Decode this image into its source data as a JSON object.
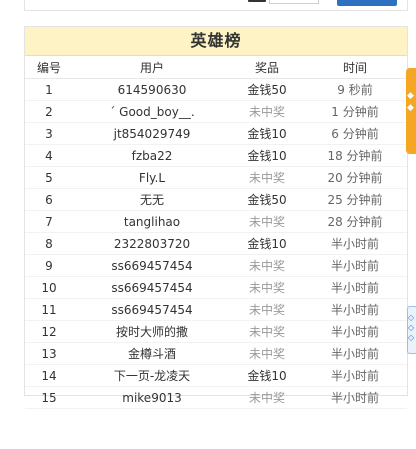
{
  "panel": {
    "title": "英雄榜",
    "columns": [
      "编号",
      "用户",
      "奖品",
      "时间"
    ]
  },
  "rows": [
    {
      "idx": "1",
      "user": "614590630",
      "prize": "金钱50",
      "won": true,
      "time": "9 秒前"
    },
    {
      "idx": "2",
      "user": "ˊ Good_boy__.",
      "prize": "未中奖",
      "won": false,
      "time": "1 分钟前"
    },
    {
      "idx": "3",
      "user": "jt854029749",
      "prize": "金钱10",
      "won": true,
      "time": "6 分钟前"
    },
    {
      "idx": "4",
      "user": "fzba22",
      "prize": "金钱10",
      "won": true,
      "time": "18 分钟前"
    },
    {
      "idx": "5",
      "user": "Fly.L",
      "prize": "未中奖",
      "won": false,
      "time": "20 分钟前"
    },
    {
      "idx": "6",
      "user": "无无",
      "prize": "金钱50",
      "won": true,
      "time": "25 分钟前"
    },
    {
      "idx": "7",
      "user": "tanglihao",
      "prize": "未中奖",
      "won": false,
      "time": "28 分钟前"
    },
    {
      "idx": "8",
      "user": "2322803720",
      "prize": "金钱10",
      "won": true,
      "time": "半小时前"
    },
    {
      "idx": "9",
      "user": "ss669457454",
      "prize": "未中奖",
      "won": false,
      "time": "半小时前"
    },
    {
      "idx": "10",
      "user": "ss669457454",
      "prize": "未中奖",
      "won": false,
      "time": "半小时前"
    },
    {
      "idx": "11",
      "user": "ss669457454",
      "prize": "未中奖",
      "won": false,
      "time": "半小时前"
    },
    {
      "idx": "12",
      "user": "按时大师的撒",
      "prize": "未中奖",
      "won": false,
      "time": "半小时前"
    },
    {
      "idx": "13",
      "user": "金樽斗酒",
      "prize": "未中奖",
      "won": false,
      "time": "半小时前"
    },
    {
      "idx": "14",
      "user": "下一页-龙凌天",
      "prize": "金钱10",
      "won": true,
      "time": "半小时前"
    },
    {
      "idx": "15",
      "user": "mike9013",
      "prize": "未中奖",
      "won": false,
      "time": "半小时前"
    }
  ],
  "side_tabs": {
    "orange_icon": "feedback-tab-icon",
    "blue_icon": "contact-tab-icon"
  },
  "colors": {
    "header_bg": "#fdf3c4",
    "prize_none": "#999999",
    "side_tab_orange": "#f5a623",
    "top_button_blue": "#2f6fbf"
  }
}
